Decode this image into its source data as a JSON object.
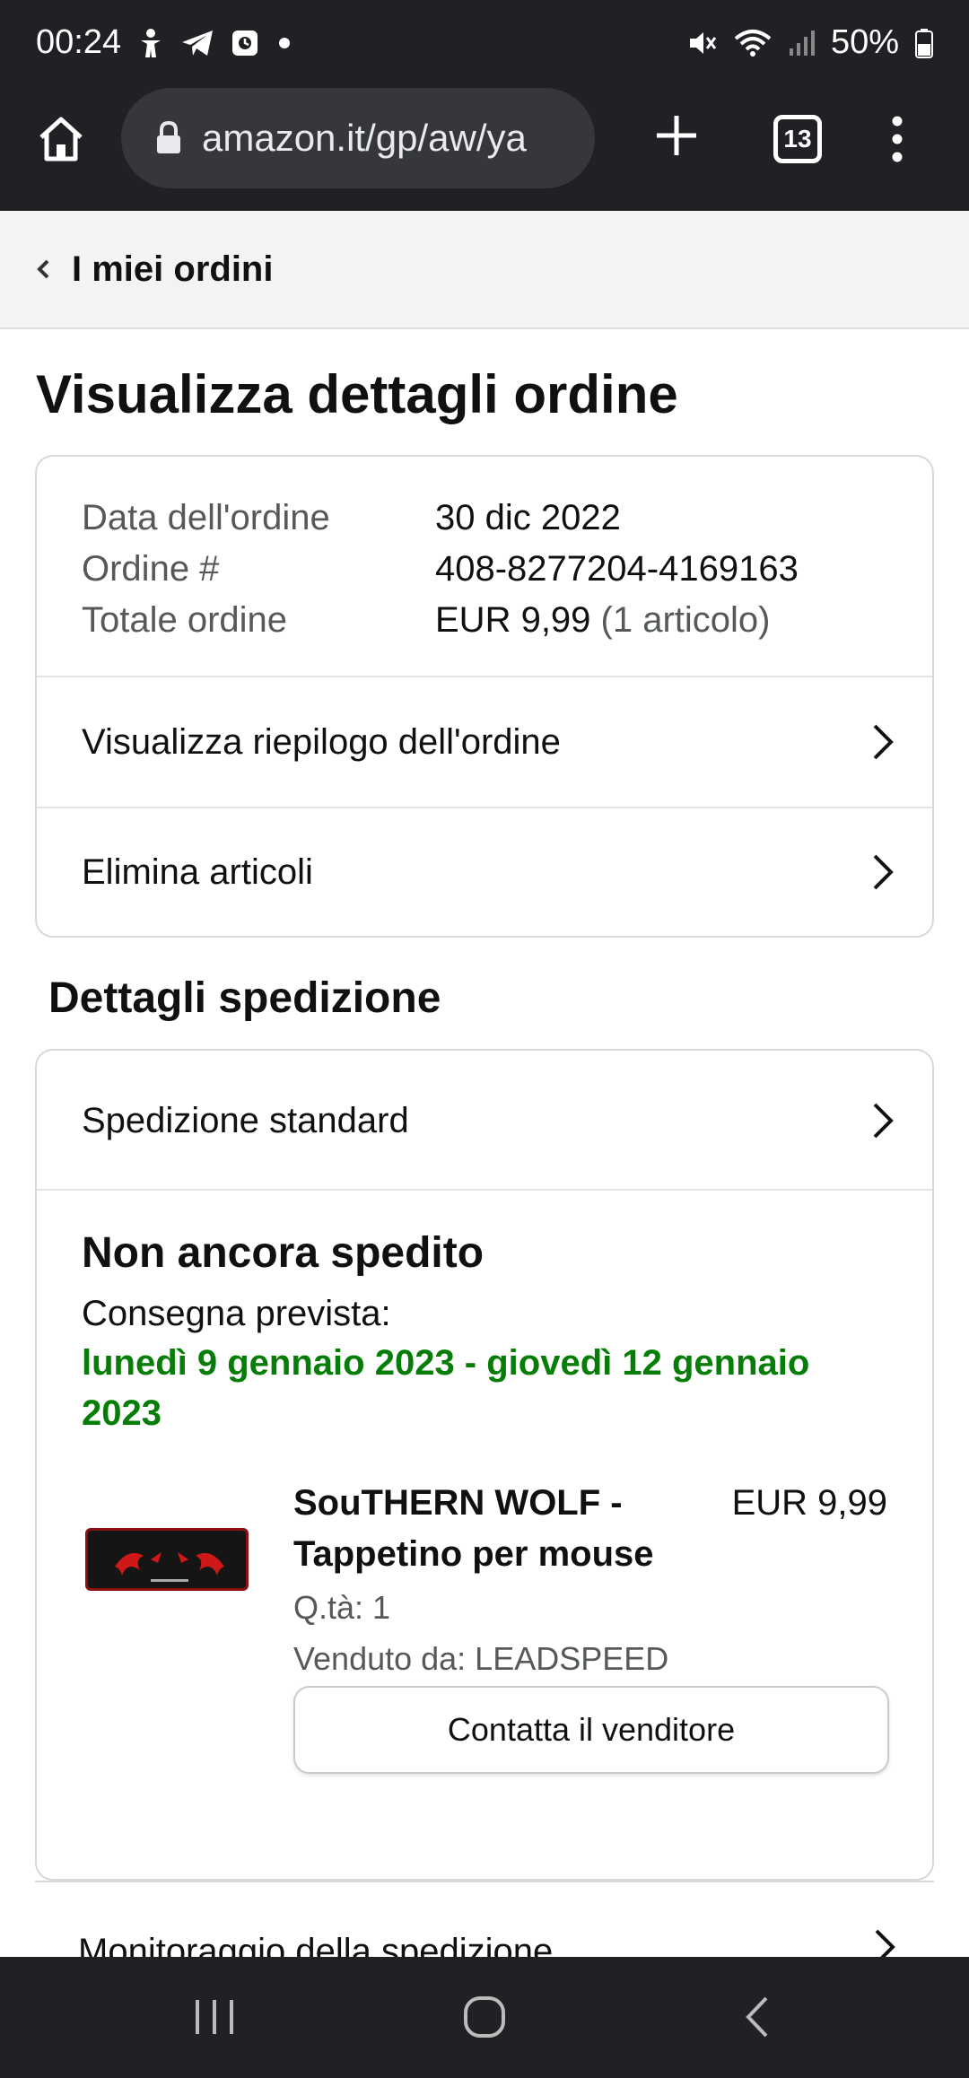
{
  "status_bar": {
    "time": "00:24",
    "battery": "50%",
    "icons": [
      "accessibility-icon",
      "telegram-icon",
      "app-icon",
      "dot-icon",
      "mute-icon",
      "wifi-icon",
      "signal-icon",
      "battery-icon"
    ]
  },
  "browser": {
    "url": "amazon.it/gp/aw/ya",
    "tab_count": "13",
    "icons": [
      "home-icon",
      "lock-icon",
      "plus-icon",
      "menu-dots-icon"
    ]
  },
  "nav": {
    "back_label": "I miei ordini"
  },
  "page": {
    "title": "Visualizza dettagli ordine"
  },
  "order_summary": {
    "date_label": "Data dell'ordine",
    "date_value": "30 dic 2022",
    "number_label": "Ordine #",
    "number_value": "408-8277204-4169163",
    "total_label": "Totale ordine",
    "total_value": "EUR 9,99",
    "total_items": "(1 articolo)",
    "links": [
      "Visualizza riepilogo dell'ordine",
      "Elimina articoli"
    ]
  },
  "shipment": {
    "heading": "Dettagli spedizione",
    "method": "Spedizione standard",
    "status": "Non ancora spedito",
    "expected_label": "Consegna prevista:",
    "expected_dates": "lunedì 9 gennaio 2023 - giovedì 12 gennaio 2023",
    "accent_color": "#067d06"
  },
  "product": {
    "title": "SouTHERN WOLF - Tappetino per mouse",
    "price": "EUR 9,99",
    "quantity": "Q.tà: 1",
    "seller": "Venduto da: LEADSPEED",
    "contact_button": "Contatta il venditore"
  },
  "tracking": {
    "label": "Monitoraggio della spedizione"
  },
  "android_nav": {
    "icons": [
      "recent-apps-icon",
      "home-circle-icon",
      "back-icon"
    ]
  }
}
